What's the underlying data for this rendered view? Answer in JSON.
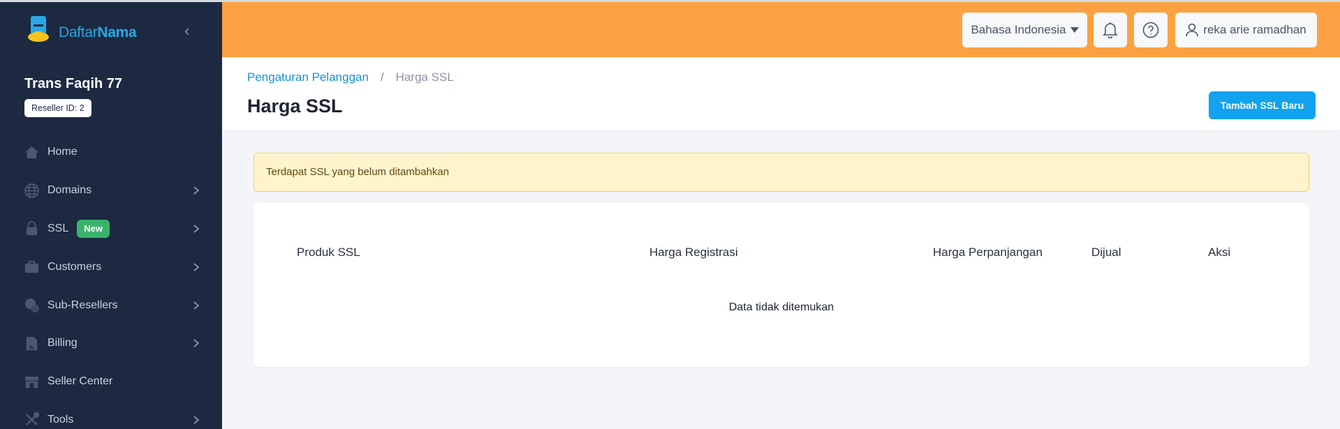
{
  "brand": {
    "name_part1": "Daftar",
    "name_part2": "Nama",
    "tagline": ""
  },
  "sidebar": {
    "org_name": "Trans Faqih 77",
    "reseller_badge": "Reseller ID: 2",
    "items": [
      {
        "label": "Home",
        "icon": "home-icon",
        "has_chevron": false
      },
      {
        "label": "Domains",
        "icon": "globe-icon",
        "has_chevron": true
      },
      {
        "label": "SSL",
        "icon": "lock-icon",
        "has_chevron": true,
        "badge": "New"
      },
      {
        "label": "Customers",
        "icon": "briefcase-icon",
        "has_chevron": true
      },
      {
        "label": "Sub-Resellers",
        "icon": "users-icon",
        "has_chevron": true
      },
      {
        "label": "Billing",
        "icon": "document-icon",
        "has_chevron": true
      },
      {
        "label": "Seller Center",
        "icon": "store-icon",
        "has_chevron": false
      },
      {
        "label": "Tools",
        "icon": "tools-icon",
        "has_chevron": true
      }
    ]
  },
  "header": {
    "language": "Bahasa Indonesia",
    "user_name": "reka arie ramadhan",
    "colors": {
      "bar": "#fba141"
    }
  },
  "page": {
    "breadcrumb": {
      "parent": "Pengaturan Pelanggan",
      "current": "Harga SSL"
    },
    "title": "Harga SSL",
    "add_button": "Tambah SSL Baru",
    "alert": "Terdapat SSL yang belum ditambahkan",
    "table": {
      "columns": [
        "Produk SSL",
        "Harga Registrasi",
        "Harga Perpanjangan",
        "Dijual",
        "Aksi"
      ],
      "empty_text": "Data tidak ditemukan"
    }
  },
  "colors": {
    "sidebar": "#1c2940",
    "primary": "#11a3ef",
    "alert_bg": "#fff4cc",
    "badge_new": "#3ab36a"
  }
}
